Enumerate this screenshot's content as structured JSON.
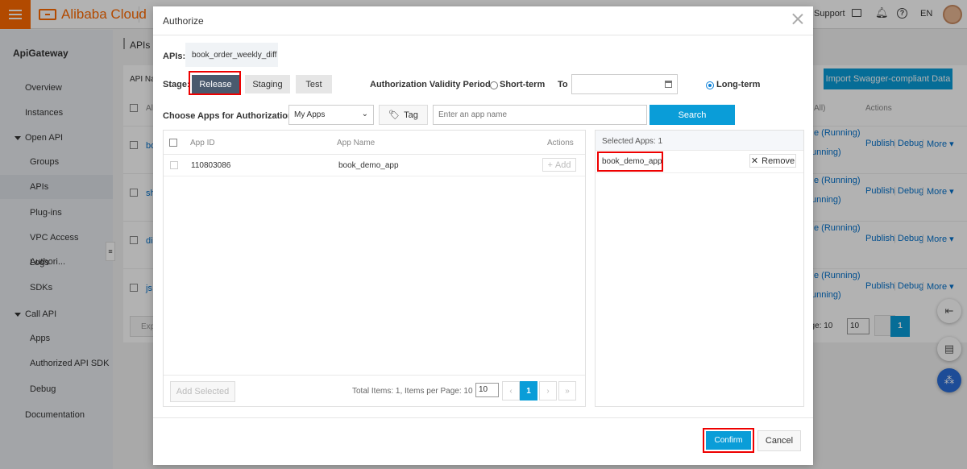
{
  "topbar": {
    "brand": "Alibaba Cloud",
    "support": "Support",
    "lang": "EN"
  },
  "sidebar": {
    "title": "ApiGateway",
    "items": [
      "Overview",
      "Instances",
      "Open API",
      "Groups",
      "APIs",
      "Plug-ins",
      "VPC Access Authori...",
      "Logs",
      "SDKs",
      "Call API",
      "Apps",
      "Authorized API SDK",
      "Debug",
      "Documentation"
    ]
  },
  "main": {
    "title": "APIs",
    "filter_prefix": "API Na",
    "import_button": "Import Swagger-compliant Data",
    "col_prefix": "Al",
    "status_filter": "All)",
    "actions_header": "Actions",
    "export_prefix": "Exp",
    "rows": [
      {
        "prefix": "bo",
        "status1": "e (Running)",
        "status2": "unning)"
      },
      {
        "prefix": "sh",
        "status1": "e (Running)",
        "status2": "unning)"
      },
      {
        "prefix": "di",
        "status1": "e (Running)",
        "status2": ""
      },
      {
        "prefix": "js",
        "status1": "e (Running)",
        "status2": "unning)"
      }
    ],
    "row_actions": {
      "publish": "Publish",
      "debug": "Debug",
      "more": "More",
      "sep": "|"
    },
    "pager": {
      "label": "age: 10",
      "size": "10",
      "page": "1"
    }
  },
  "dialog": {
    "title": "Authorize",
    "apis_label": "APIs:",
    "api_name": "book_order_weekly_diff",
    "stage_label": "Stage:",
    "stages": {
      "release": "Release",
      "staging": "Staging",
      "test": "Test"
    },
    "validity_label": "Authorization Validity Period:",
    "short_term": "Short-term",
    "to_label": "To",
    "long_term": "Long-term",
    "choose_label": "Choose Apps for Authorization:",
    "source_select": "My Apps",
    "tag_button": "Tag",
    "search_placeholder": "Enter an app name",
    "search_button": "Search",
    "table": {
      "headers": {
        "id": "App ID",
        "name": "App Name",
        "actions": "Actions"
      },
      "rows": [
        {
          "id": "110803086",
          "name": "book_demo_app",
          "action": "Add"
        }
      ]
    },
    "add_selected": "Add Selected",
    "pagination": {
      "summary": "Total Items: 1, Items per Page: 10",
      "per_page": "10",
      "current": "1",
      "prev": "‹",
      "first": "«",
      "next": "›",
      "last": "»"
    },
    "selected": {
      "header": "Selected Apps: 1",
      "apps": [
        {
          "name": "book_demo_app",
          "remove": "Remove"
        }
      ]
    },
    "confirm": "Confirm",
    "cancel": "Cancel"
  },
  "colors": {
    "accent": "#ff6a00",
    "primary": "#0a9dd8",
    "highlight": "#e00000",
    "stage_active": "#4a5a6e"
  }
}
